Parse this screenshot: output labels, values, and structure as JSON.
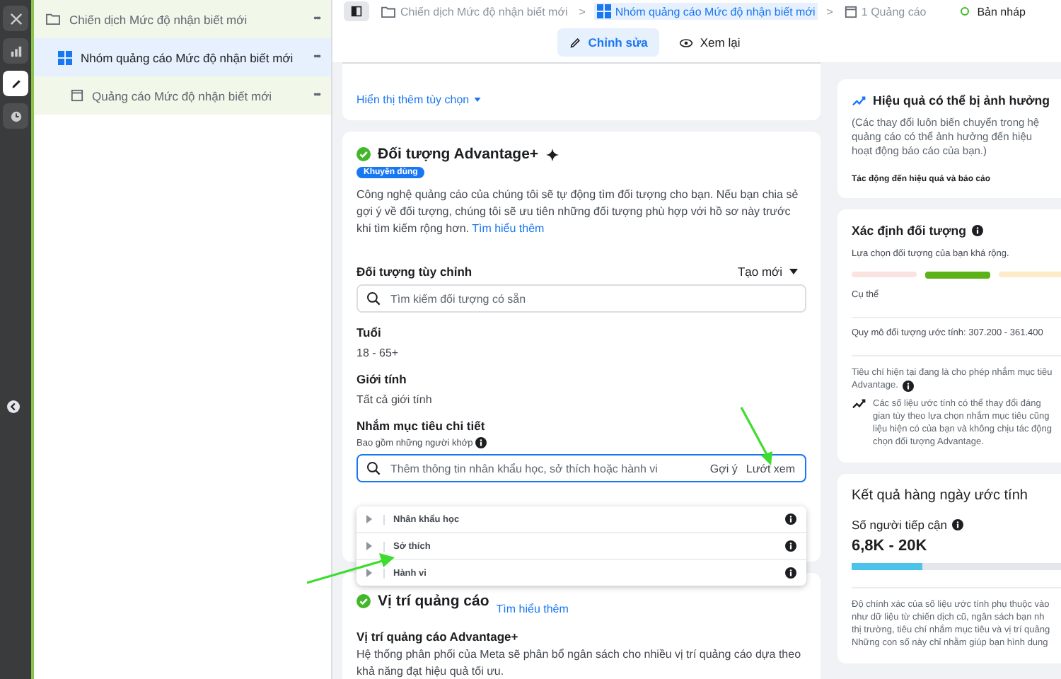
{
  "rail": {
    "items": [
      {
        "kind": "close",
        "selected": false
      },
      {
        "kind": "chart",
        "selected": false
      },
      {
        "kind": "edit",
        "selected": true
      },
      {
        "kind": "history",
        "selected": false
      }
    ]
  },
  "sidebar": {
    "items": [
      {
        "kind": "campaign",
        "label": "Chiến dịch Mức độ nhận biết mới",
        "selected": false,
        "more": "•••",
        "children": [
          {
            "kind": "adset",
            "label": "Nhóm quảng cáo Mức độ nhận biết mới",
            "selected": true,
            "more": "•••",
            "children": [
              {
                "kind": "ad",
                "label": "Quảng cáo Mức độ nhận biết mới",
                "selected": false,
                "more": "•••"
              }
            ]
          }
        ]
      }
    ]
  },
  "breadcrumb": {
    "items": [
      {
        "kind": "campaign",
        "label": "Chiến dịch Mức độ nhận biết mới",
        "selected": false
      },
      {
        "kind": "adset",
        "label": "Nhóm quảng cáo Mức độ nhận biết mới",
        "selected": true
      },
      {
        "kind": "ad",
        "label": "1 Quảng cáo",
        "selected": false
      }
    ],
    "separator": ">",
    "status": {
      "label": "Bản nháp",
      "color": "#42b72a"
    }
  },
  "mode_tabs": [
    {
      "kind": "edit",
      "label": "Chỉnh sửa",
      "selected": true
    },
    {
      "kind": "review",
      "label": "Xem lại",
      "selected": false
    }
  ],
  "options_card": {
    "link": "Hiển thị thêm tùy chọn"
  },
  "audience_card": {
    "title": "Đối tượng Advantage+",
    "badge": "Khuyên dùng",
    "description": "Công nghệ quảng cáo của chúng tôi sẽ tự động tìm đối tượng cho bạn. Nếu bạn chia sẻ gợi ý về đối tượng, chúng tôi sẽ ưu tiên những đối tượng phù hợp với hồ sơ này trước khi tìm kiếm rộng hơn.",
    "learn_more": "Tìm hiểu thêm",
    "custom_audience": {
      "label": "Đối tượng tùy chỉnh",
      "create": "Tạo mới",
      "placeholder": "Tìm kiếm đối tượng có sẵn"
    },
    "age": {
      "label": "Tuổi",
      "value": "18 - 65+"
    },
    "gender": {
      "label": "Giới tính",
      "value": "Tất cả giới tính"
    },
    "detailed": {
      "label": "Nhắm mục tiêu chi tiết",
      "sublabel": "Bao gồm những người khớp",
      "placeholder": "Thêm thông tin nhân khẩu học, sở thích hoặc hành vi",
      "suggest": "Gợi ý",
      "browse": "Lướt xem",
      "categories": [
        {
          "label": "Nhân khẩu học",
          "expanded": false
        },
        {
          "label": "Sở thích",
          "expanded": false
        },
        {
          "label": "Hành vi",
          "expanded": false
        }
      ]
    }
  },
  "placement_card": {
    "title": "Vị trí quảng cáo",
    "learn_more": "Tìm hiểu thêm",
    "subtitle": "Vị trí quảng cáo Advantage+",
    "description": "Hệ thống phân phối của Meta sẽ phân bổ ngân sách cho nhiều vị trí quảng cáo dựa theo khả năng đạt hiệu quả tối ưu."
  },
  "performance_card": {
    "title": "Hiệu quả có thể bị ảnh hưởng",
    "lines": [
      "(Các thay đổi luôn biến chuyển trong hệ",
      "quảng cáo có thể ảnh hưởng đến hiệu",
      "hoạt động báo cáo của bạn.)"
    ],
    "footer": "Tác động đến hiệu quả và báo cáo"
  },
  "definition_card": {
    "title": "Xác định đối tượng",
    "note": "Lựa chọn đối tượng của bạn khá rộng.",
    "segments": [
      {
        "selected": false,
        "color": "#fbe3e1"
      },
      {
        "selected": true,
        "color": "#5bb318"
      },
      {
        "selected": false,
        "color": "#fdecc8"
      }
    ],
    "scale_label": "Cụ thể",
    "size": "Quy mô đối tượng ước tính: 307.200 - 361.400",
    "criteria": [
      "Tiêu chí hiện tại đang là cho phép nhắm mục tiêu",
      "Advantage."
    ],
    "estimate_lines": [
      "Các số liệu ước tính có thể thay đổi đáng",
      "gian tùy theo lựa chọn nhắm mục tiêu cũng",
      "liệu hiện có của bạn và không chịu tác động",
      "chọn đối tượng Advantage."
    ]
  },
  "daily_card": {
    "title": "Kết quả hàng ngày ước tính",
    "reach_label": "Số người tiếp cận",
    "reach": "6,8K - 20K",
    "level": 0.33,
    "lines": [
      "Độ chính xác của số liệu ước tính phụ thuộc vào",
      "như dữ liệu từ chiến dịch cũ, ngân sách bạn nh",
      "thị trường, tiêu chí nhắm mục tiêu và vị trí quảng",
      "Những con số này chỉ nhằm giúp bạn hình dung"
    ]
  },
  "annotation_arrows": [
    {
      "kind": "arrow"
    },
    {
      "kind": "arrow"
    }
  ]
}
